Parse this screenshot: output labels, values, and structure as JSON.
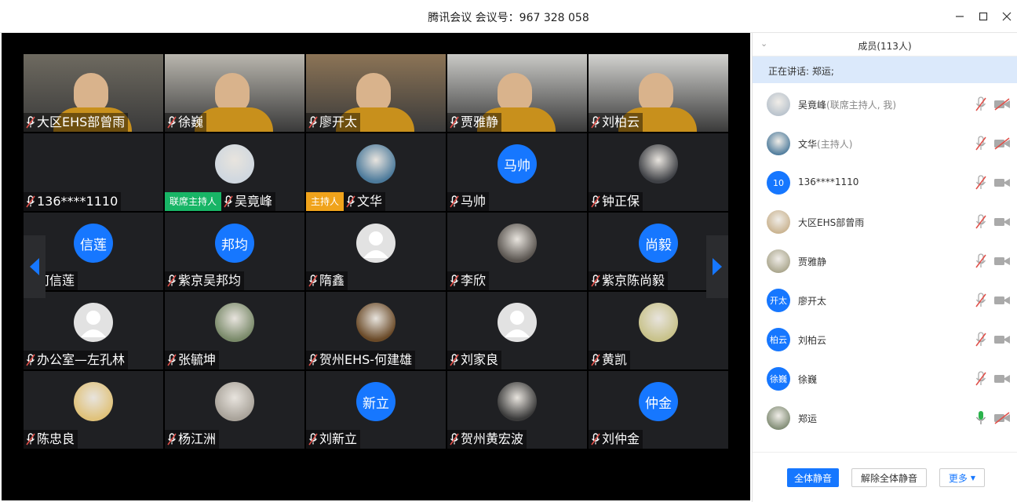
{
  "window": {
    "title": "腾讯会议 会议号：967 328 058"
  },
  "grid_tiles": [
    {
      "name": "大区EHS部曾雨",
      "kind": "camera",
      "cam": "#6e6a60"
    },
    {
      "name": "徐巍",
      "kind": "camera",
      "cam": "#b9b6ae"
    },
    {
      "name": "廖开太",
      "kind": "camera",
      "cam": "#8c7456"
    },
    {
      "name": "贾雅静",
      "kind": "camera",
      "cam": "#c9c9c6"
    },
    {
      "name": "刘柏云",
      "kind": "camera",
      "cam": "#d2d2cf"
    },
    {
      "name": "136****1110",
      "kind": "empty"
    },
    {
      "name": "吴竟峰",
      "kind": "photo",
      "role": "联席主持人",
      "role_color": "#18b566",
      "avatar_color": "#cfd7df"
    },
    {
      "name": "文华",
      "kind": "photo",
      "role": "主持人",
      "role_color": "#f0a31b",
      "avatar_color": "#4c7a9b"
    },
    {
      "name": "马帅",
      "kind": "text",
      "avatar_text": "马帅"
    },
    {
      "name": "钟正保",
      "kind": "photo",
      "avatar_color": "#3f4146"
    },
    {
      "name": "何信莲",
      "kind": "text",
      "avatar_text": "信莲"
    },
    {
      "name": "紫京吴邦均",
      "kind": "text",
      "avatar_text": "邦均"
    },
    {
      "name": "隋鑫",
      "kind": "default"
    },
    {
      "name": "李欣",
      "kind": "photo",
      "avatar_color": "#5a5550"
    },
    {
      "name": "紫京陈尚毅",
      "kind": "text",
      "avatar_text": "尚毅"
    },
    {
      "name": "办公室—左孔林",
      "kind": "default"
    },
    {
      "name": "张毓坤",
      "kind": "photo",
      "avatar_color": "#7a8a6a"
    },
    {
      "name": "贺州EHS-何建雄",
      "kind": "photo",
      "avatar_color": "#6a4a28"
    },
    {
      "name": "刘家良",
      "kind": "default"
    },
    {
      "name": "黄凯",
      "kind": "photo",
      "avatar_color": "#c8c28a"
    },
    {
      "name": "陈忠良",
      "kind": "photo",
      "avatar_color": "#e0c27a"
    },
    {
      "name": "杨江洲",
      "kind": "photo",
      "avatar_color": "#a9a39a"
    },
    {
      "name": "刘新立",
      "kind": "text",
      "avatar_text": "新立"
    },
    {
      "name": "贺州黄宏波",
      "kind": "photo",
      "avatar_color": "#3a3a3a"
    },
    {
      "name": "刘仲金",
      "kind": "text",
      "avatar_text": "仲金"
    }
  ],
  "sidebar": {
    "title": "成员(113人)",
    "speaking": "正在讲话: 郑运;",
    "members": [
      {
        "name": "吴竟峰",
        "role": "(联席主持人, 我)",
        "avatar": "",
        "avatar_color": "#b8c2cc",
        "mic": "muted",
        "cam": "off"
      },
      {
        "name": "文华",
        "role": "(主持人)",
        "avatar": "",
        "avatar_color": "#4c7a9b",
        "mic": "muted",
        "cam": "off"
      },
      {
        "name": "136****1110",
        "role": "",
        "avatar": "10",
        "avatar_color": "#1677ff",
        "mic": "muted",
        "cam": "on"
      },
      {
        "name": "大区EHS部曾雨",
        "role": "",
        "avatar": "",
        "avatar_color": "#c9b28e",
        "mic": "muted",
        "cam": "on"
      },
      {
        "name": "贾雅静",
        "role": "",
        "avatar": "",
        "avatar_color": "#a9a58c",
        "mic": "muted",
        "cam": "on"
      },
      {
        "name": "廖开太",
        "role": "",
        "avatar": "开太",
        "avatar_color": "#1677ff",
        "mic": "muted",
        "cam": "on"
      },
      {
        "name": "刘柏云",
        "role": "",
        "avatar": "柏云",
        "avatar_color": "#1677ff",
        "mic": "muted",
        "cam": "on"
      },
      {
        "name": "徐巍",
        "role": "",
        "avatar": "徐巍",
        "avatar_color": "#1677ff",
        "mic": "muted",
        "cam": "on"
      },
      {
        "name": "郑运",
        "role": "",
        "avatar": "",
        "avatar_color": "#7e8a72",
        "mic": "active",
        "cam": "off"
      }
    ],
    "buttons": {
      "mute_all": "全体静音",
      "unmute_all": "解除全体静音",
      "more": "更多"
    }
  },
  "colors": {
    "accent": "#1677ff",
    "mic_muted": "#e0504a",
    "mic_active": "#2bb24c",
    "speaking_bg": "#dbe9fb"
  }
}
